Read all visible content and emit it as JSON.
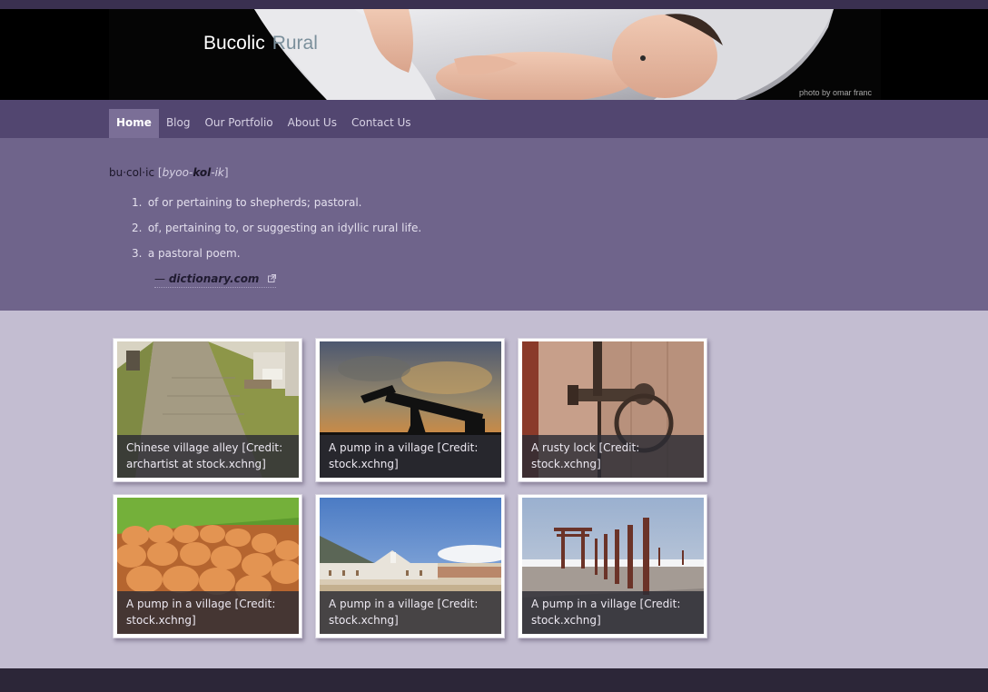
{
  "site": {
    "title_part1": "Bucolic",
    "title_part2": "Rural",
    "photo_credit": "photo by omar franc"
  },
  "nav": {
    "items": [
      {
        "label": "Home",
        "active": true
      },
      {
        "label": "Blog"
      },
      {
        "label": "Our Portfolio"
      },
      {
        "label": "About Us"
      },
      {
        "label": "Contact Us"
      }
    ]
  },
  "definition": {
    "word": "bu·col·ic",
    "bracket_open": "[",
    "pron_start": "byoo-",
    "pron_stress": "kol",
    "pron_end": "-ik",
    "bracket_close": "]",
    "senses": [
      {
        "num": "1.",
        "text": "of or pertaining to shepherds; pastoral."
      },
      {
        "num": "2.",
        "text": "of, pertaining to, or suggesting an idyllic rural life."
      },
      {
        "num": "3.",
        "text": "a pastoral poem."
      }
    ],
    "source_dash": "—",
    "source_label": "dictionary.com"
  },
  "gallery": {
    "items": [
      {
        "caption": "Chinese village alley [Credit: archartist at stock.xchng]",
        "icon": "village-alley-photo"
      },
      {
        "caption": "A pump in a village [Credit: stock.xchng]",
        "icon": "oil-pump-photo"
      },
      {
        "caption": "A rusty lock [Credit: stock.xchng]",
        "icon": "rusty-lock-photo"
      },
      {
        "caption": "A pump in a village [Credit: stock.xchng]",
        "icon": "eggs-photo"
      },
      {
        "caption": "A pump in a village [Credit: stock.xchng]",
        "icon": "village-church-photo"
      },
      {
        "caption": "A pump in a village [Credit: stock.xchng]",
        "icon": "beach-gate-photo"
      }
    ]
  },
  "colors": {
    "header_bg": "#000000",
    "nav_bg": "#524670",
    "nav_active": "#7b6f97",
    "intro_bg": "#6f648b",
    "page_bg": "#c3bdd1",
    "footer_bg": "#2c2638"
  }
}
